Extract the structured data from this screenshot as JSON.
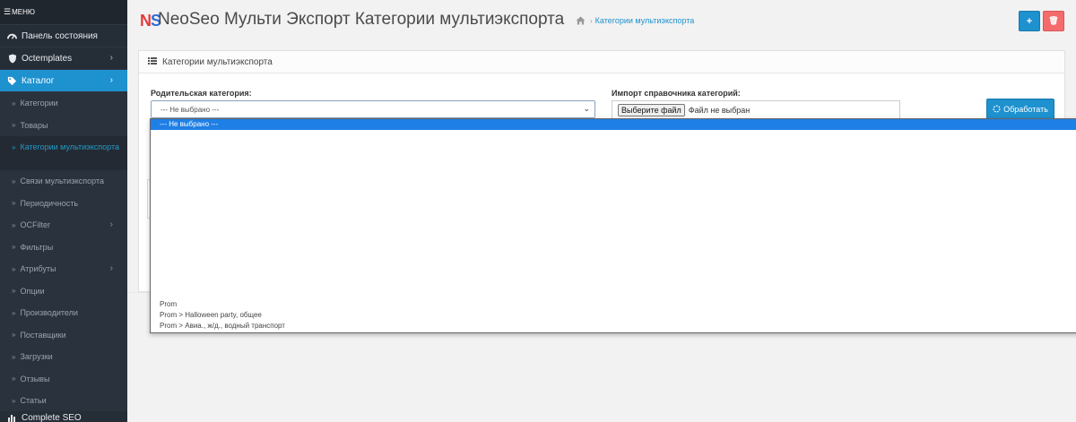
{
  "sidebar": {
    "menu_label": "МЕНЮ",
    "items": [
      {
        "label": "Панель состояния",
        "icon": "dashboard-icon",
        "has_chevron": false
      },
      {
        "label": "Octemplates",
        "icon": "shield-icon",
        "has_chevron": true
      },
      {
        "label": "Каталог",
        "icon": "tag-icon",
        "has_chevron": true,
        "active": true
      }
    ],
    "sub_items": [
      {
        "label": "Категории"
      },
      {
        "label": "Товары"
      },
      {
        "label": "Категории мультиэкспорта",
        "active": true
      },
      {
        "label": "Связи мультиэкспорта"
      },
      {
        "label": "Периодичность"
      },
      {
        "label": "OCFilter",
        "has_chevron": true
      },
      {
        "label": "Фильтры"
      },
      {
        "label": "Атрибуты",
        "has_chevron": true
      },
      {
        "label": "Опции"
      },
      {
        "label": "Производители"
      },
      {
        "label": "Поставщики"
      },
      {
        "label": "Загрузки"
      },
      {
        "label": "Отзывы"
      },
      {
        "label": "Статьи"
      }
    ],
    "bottom_item": {
      "label": "Complete SEO",
      "icon": "chart-icon"
    }
  },
  "header": {
    "logo_n": "N",
    "logo_s": "S",
    "title": "NeoSeo Мульти Экспорт Категории мультиэкспорта",
    "breadcrumb": {
      "separator": "›",
      "current": "Категории мультиэкспорта"
    },
    "add_label": "+",
    "delete_label": "🗑"
  },
  "panel": {
    "title": "Категории мультиэкспорта",
    "parent_label": "Родительская категория:",
    "parent_value": "--- Не выбрано ---",
    "import_label": "Импорт справочника категорий:",
    "file_button": "Выберите файл",
    "file_status": "Файл не выбран",
    "process_button": "Обработать"
  },
  "dropdown": {
    "selected": "--- Не выбрано ---",
    "options": [
      "Prom",
      "Prom > Halloween party, общее",
      "Prom > Авиа., ж/д., водный транспорт"
    ]
  },
  "colors": {
    "accent": "#1e91cf",
    "danger": "#f56b6b",
    "sidebar_bg": "#252d37",
    "selected_option": "#1e7fe6"
  }
}
